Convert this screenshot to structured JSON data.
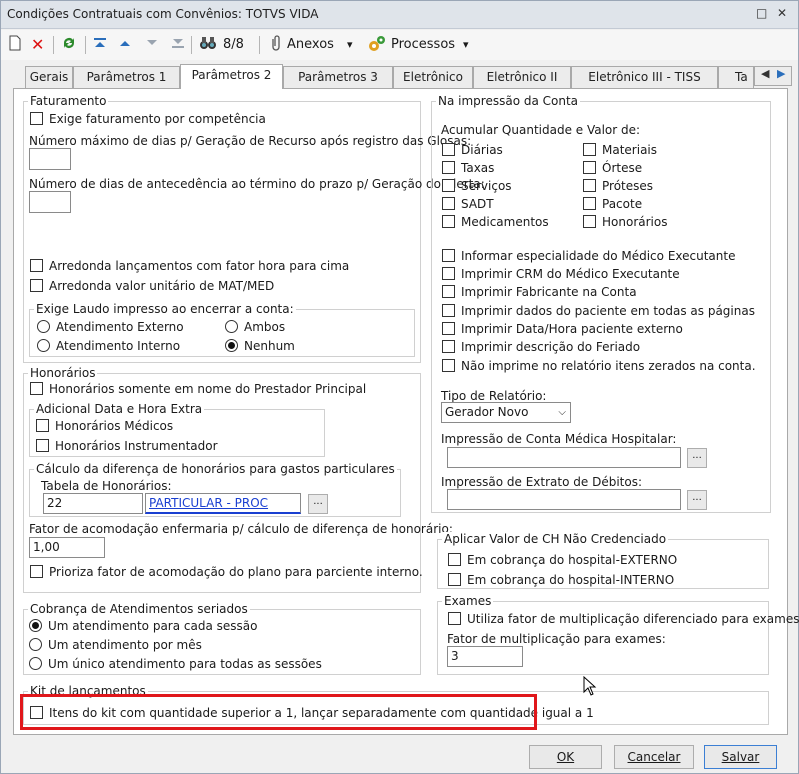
{
  "window": {
    "title": "Condições Contratuais com Convênios: TOTVS VIDA",
    "btn_restore": "□",
    "btn_close": "✕"
  },
  "toolbar": {
    "counter": "8/8",
    "anexos": "Anexos",
    "processos": "Processos",
    "dropdown_glyph": "▾"
  },
  "tabs": [
    "Gerais",
    "Parâmetros 1",
    "Parâmetros 2",
    "Parâmetros 3",
    "Eletrônico",
    "Eletrônico II",
    "Eletrônico III - TISS",
    "Ta"
  ],
  "faturamento": {
    "legend": "Faturamento",
    "exige_competencia": "Exige faturamento por competência",
    "max_dias_label": "Número máximo de dias p/ Geração de Recurso após registro das Glosas:",
    "dias_antec_label": "Número de dias de antecedência ao término do prazo p/ Geração do Alerta:",
    "arredonda_hora": "Arredonda lançamentos com fator hora para cima",
    "arredonda_mat": "Arredonda valor unitário de MAT/MED"
  },
  "laudo": {
    "legend": "Exige Laudo impresso ao encerrar a conta:",
    "options": [
      "Atendimento Externo",
      "Ambos",
      "Atendimento Interno",
      "Nenhum"
    ],
    "selected": "Nenhum"
  },
  "honorarios": {
    "legend": "Honorários",
    "somente_prestador": "Honorários somente em nome do Prestador Principal",
    "adicional_legend": "Adicional Data e Hora Extra",
    "medicos": "Honorários Médicos",
    "instrumentador": "Honorários Instrumentador",
    "calculo_legend": "Cálculo da diferença de honorários para gastos particulares",
    "tabela_label": "Tabela de Honorários:",
    "tabela_code": "22",
    "tabela_name": "PARTICULAR - PROC",
    "fator_label": "Fator de acomodação enfermaria p/ cálculo de diferença de honorário:",
    "fator_value": "1,00",
    "prioriza": "Prioriza fator de acomodação do plano para parciente interno."
  },
  "seriados": {
    "legend": "Cobrança de Atendimentos seriados",
    "options": [
      "Um atendimento para cada sessão",
      "Um atendimento por mês",
      "Um único atendimento para todas as sessões"
    ],
    "selected": "Um atendimento para cada sessão"
  },
  "kit": {
    "legend": "Kit de lançamentos",
    "itens": "Itens do kit com quantidade superior a 1, lançar separadamente com quantidade igual a 1"
  },
  "impressao": {
    "legend": "Na impressão da Conta",
    "acumular_label": "Acumular Quantidade e Valor de:",
    "left_items": [
      "Diárias",
      "Taxas",
      "Serviços",
      "SADT",
      "Medicamentos"
    ],
    "right_items": [
      "Materiais",
      "Órtese",
      "Próteses",
      "Pacote",
      "Honorários"
    ],
    "options": [
      "Informar especialidade do Médico Executante",
      "Imprimir CRM do Médico Executante",
      "Imprimir Fabricante na Conta",
      "Imprimir dados do paciente em todas as páginas",
      "Imprimir Data/Hora paciente externo",
      "Imprimir descrição do Feriado",
      "Não imprime no relatório itens zerados na conta."
    ],
    "tipo_label": "Tipo de Relatório:",
    "tipo_value": "Gerador Novo",
    "conta_medica_label": "Impressão de Conta Médica Hospitalar:",
    "extrato_label": "Impressão de Extrato de Débitos:",
    "ellipsis": "..."
  },
  "ch": {
    "legend": "Aplicar Valor de CH Não Credenciado",
    "externo": "Em cobrança do hospital-EXTERNO",
    "interno": "Em cobrança do hospital-INTERNO"
  },
  "exames": {
    "legend": "Exames",
    "utiliza": "Utiliza fator de multiplicação diferenciado para exames",
    "fator_label": "Fator de multiplicação para exames:",
    "fator_value": "3"
  },
  "buttons": {
    "ok": "OK",
    "cancelar": "Cancelar",
    "salvar": "Salvar"
  }
}
